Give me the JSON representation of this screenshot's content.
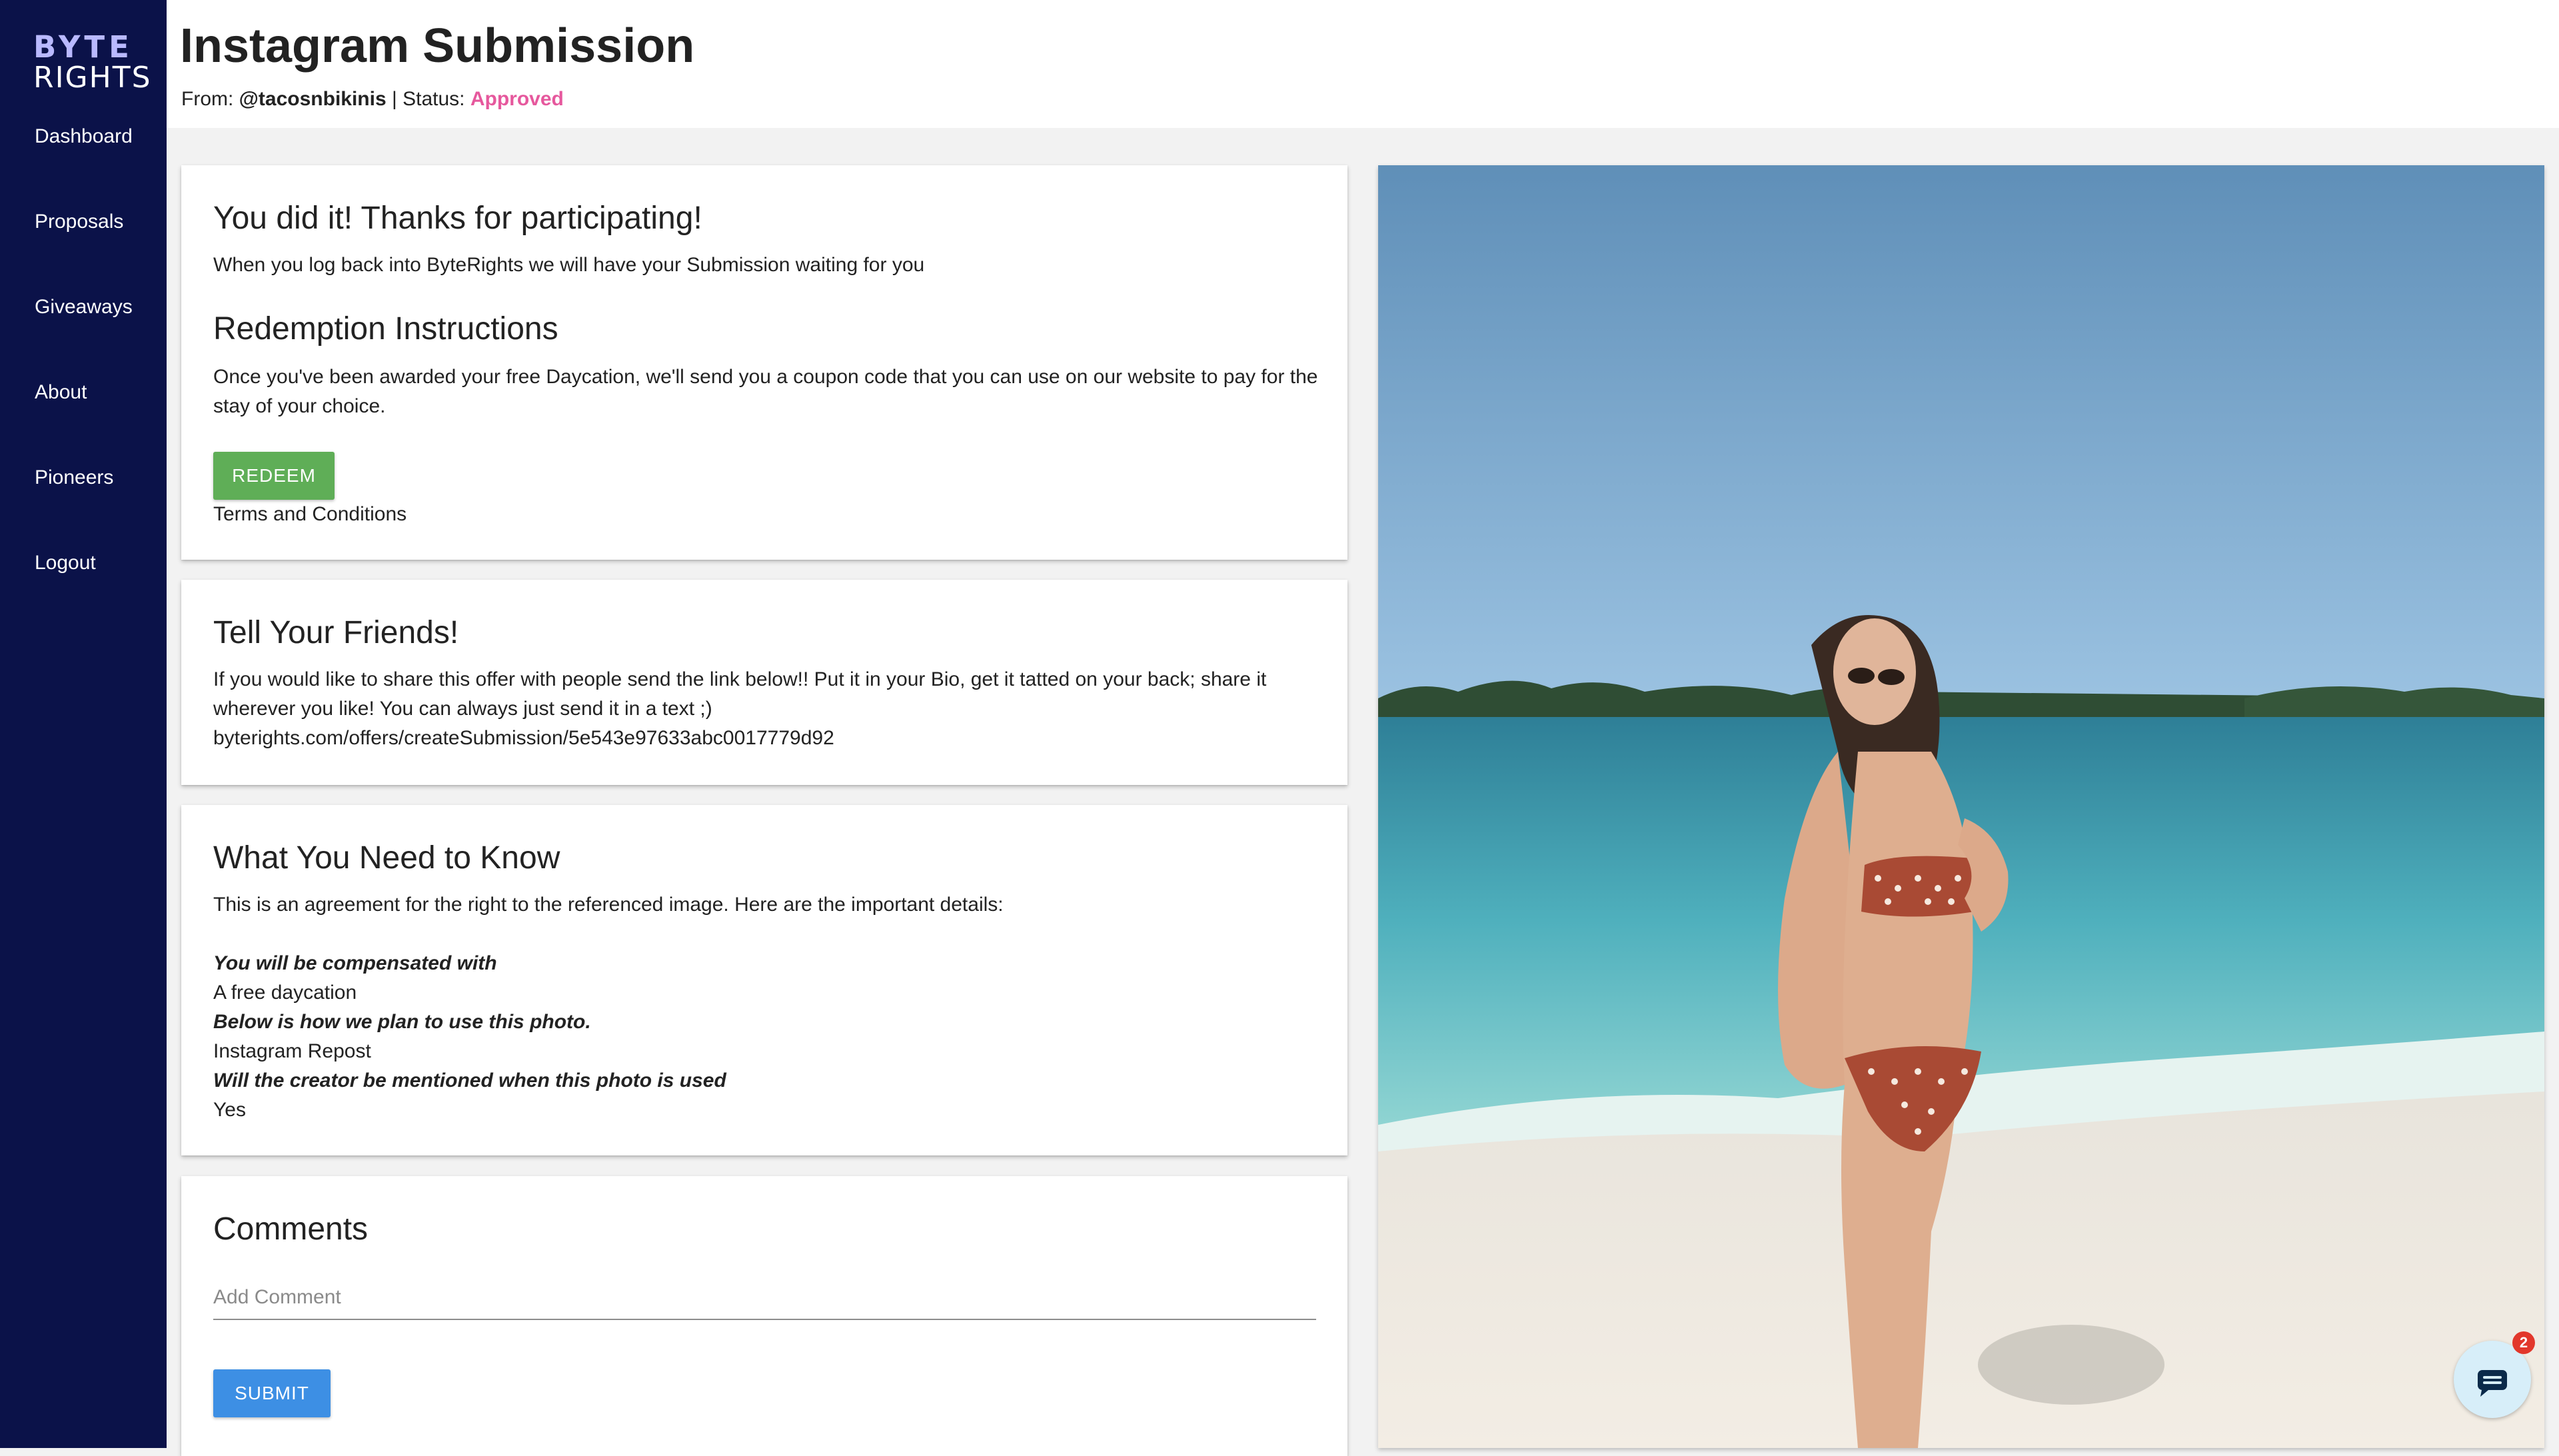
{
  "brand": {
    "logo_top": "BYTE",
    "logo_bottom": "RIGHTS"
  },
  "sidebar": {
    "items": [
      {
        "label": "Dashboard"
      },
      {
        "label": "Proposals"
      },
      {
        "label": "Giveaways"
      },
      {
        "label": "About"
      },
      {
        "label": "Pioneers"
      },
      {
        "label": "Logout"
      }
    ]
  },
  "header": {
    "title": "Instagram Submission",
    "from_label": "From:",
    "handle": "@tacosnbikinis",
    "separator": "| Status:",
    "status": "Approved"
  },
  "colors": {
    "sidebar_bg": "#0b1249",
    "status_color": "#e6589d",
    "redeem_button": "#5fae57",
    "submit_button": "#3d8fe4",
    "link_color": "#3b8ee0"
  },
  "thanks_card": {
    "heading": "You did it! Thanks for participating!",
    "text": "When you log back into ByteRights we will have your Submission waiting for you",
    "redemption_heading": "Redemption Instructions",
    "redemption_text": "Once you've been awarded your free Daycation, we'll send you a coupon code that you can use on our website to pay for the stay of your choice.",
    "redeem_label": "REDEEM",
    "terms_label": "Terms and Conditions"
  },
  "friends_card": {
    "heading": "Tell Your Friends!",
    "text": "If you would like to share this offer with people send the link below!! Put it in your Bio, get it tatted on your back; share it wherever you like! You can always just send it in a text ;)",
    "link": "byterights.com/offers/createSubmission/5e543e97633abc0017779d92"
  },
  "know_card": {
    "heading": "What You Need to Know",
    "intro": "This is an agreement for the right to the referenced image. Here are the important details:",
    "compensation_label": "You will be compensated with",
    "compensation_value": "A free daycation",
    "usage_label": "Below is how we plan to use this photo.",
    "usage_value": "Instagram Repost",
    "mention_label": "Will the creator be mentioned when this photo is used",
    "mention_value": "Yes"
  },
  "comments_card": {
    "heading": "Comments",
    "placeholder": "Add Comment",
    "submit_label": "SUBMIT"
  },
  "chat": {
    "badge_count": "2",
    "icon": "chat-icon"
  }
}
